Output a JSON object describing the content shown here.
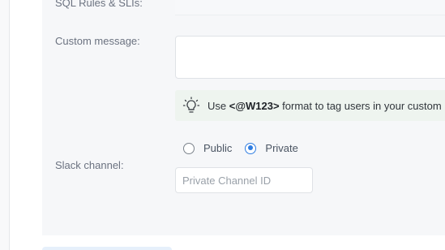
{
  "form": {
    "sql_rules_label": "SQL Rules & SLIs:",
    "custom_message_label": "Custom message:",
    "custom_message_value": "",
    "hint_prefix": "Use ",
    "hint_bold": "<@W123>",
    "hint_suffix": " format to tag users in your custom message",
    "slack_channel_label": "Slack channel:",
    "radio_public_label": "Public",
    "radio_private_label": "Private",
    "selected_visibility": "Private",
    "channel_id_placeholder": "Private Channel ID",
    "channel_id_value": ""
  },
  "colors": {
    "accent": "#2f7de1",
    "panel_bg": "#f6f7f9",
    "hint_bg": "#eef4ef"
  },
  "icons": {
    "hint": "lightbulb-icon"
  }
}
